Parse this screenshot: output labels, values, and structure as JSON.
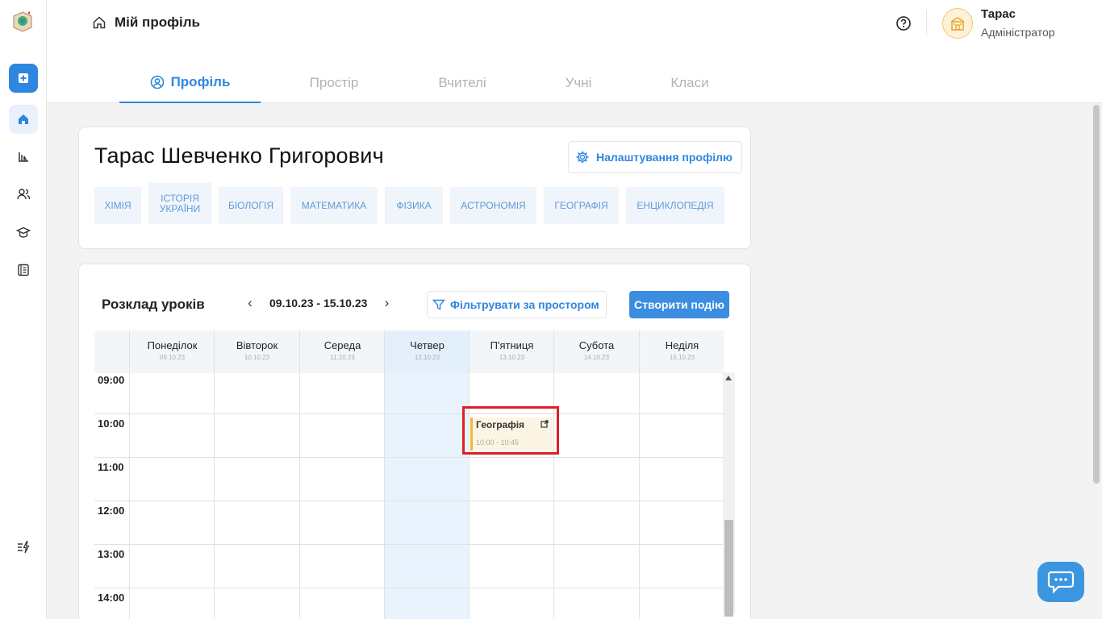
{
  "header": {
    "breadcrumb_title": "Мій профіль",
    "user": {
      "name": "Тарас",
      "role": "Адміністратор"
    }
  },
  "tabs": [
    {
      "label": "Профіль",
      "active": true
    },
    {
      "label": "Простір"
    },
    {
      "label": "Вчителі"
    },
    {
      "label": "Учні"
    },
    {
      "label": "Класи"
    }
  ],
  "profile": {
    "full_name": "Тарас Шевченко Григорович",
    "settings_label": "Налаштування профілю",
    "subjects": [
      "ХІМІЯ",
      "ІСТОРІЯ УКРАЇНИ",
      "БІОЛОГІЯ",
      "МАТЕМАТИКА",
      "ФІЗИКА",
      "АСТРОНОМІЯ",
      "ГЕОГРАФІЯ",
      "ЕНЦИКЛОПЕДІЯ"
    ]
  },
  "schedule": {
    "title": "Розклад уроків",
    "week_range": "09.10.23 - 15.10.23",
    "filter_label": "Фільтрувати за простором",
    "create_label": "Створити подію",
    "days": [
      {
        "name": "Понеділок",
        "date": "09.10.23"
      },
      {
        "name": "Вівторок",
        "date": "10.10.23"
      },
      {
        "name": "Середа",
        "date": "11.10.23"
      },
      {
        "name": "Четвер",
        "date": "12.10.23"
      },
      {
        "name": "П'ятниця",
        "date": "13.10.23"
      },
      {
        "name": "Субота",
        "date": "14.10.23"
      },
      {
        "name": "Неділя",
        "date": "15.10.23"
      }
    ],
    "hours": [
      "09:00",
      "10:00",
      "11:00",
      "12:00",
      "13:00",
      "14:00"
    ],
    "today_index": 3,
    "event": {
      "title": "Географія",
      "time": "10:00 - 10:45",
      "day": "П'ятниця"
    }
  },
  "colors": {
    "accent": "#2f86e0",
    "event_bar": "#f0b73c",
    "highlight": "#e01e26"
  }
}
